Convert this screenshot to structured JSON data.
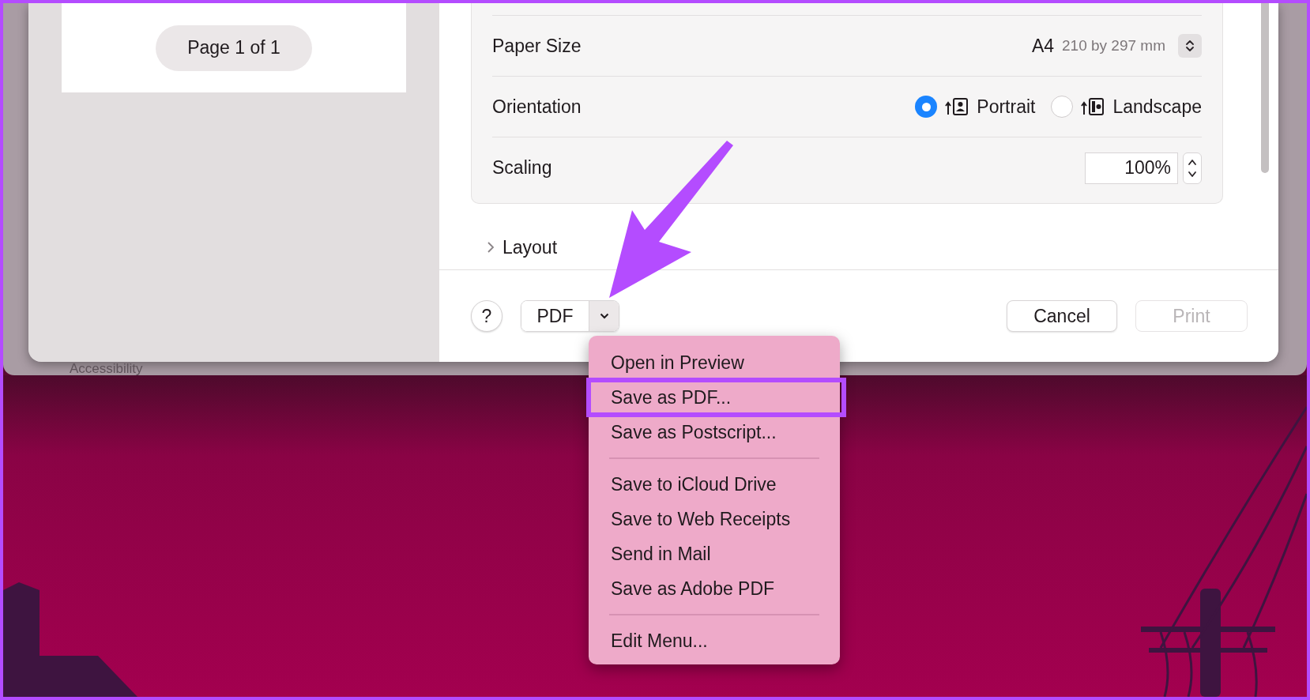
{
  "background_window": {
    "label": "Accessibility"
  },
  "preview": {
    "page_indicator": "Page 1 of 1"
  },
  "settings": {
    "rows": [
      {
        "kind": "select",
        "label": "Paper Size",
        "value": "A4",
        "detail": "210 by 297 mm"
      },
      {
        "kind": "radio",
        "label": "Orientation",
        "options": [
          {
            "label": "Portrait",
            "selected": true
          },
          {
            "label": "Landscape",
            "selected": false
          }
        ]
      },
      {
        "kind": "stepper",
        "label": "Scaling",
        "value": "100%"
      }
    ]
  },
  "sections": [
    {
      "label": "Layout",
      "expanded": false
    }
  ],
  "footer": {
    "help": "?",
    "pdf": "PDF",
    "cancel": "Cancel",
    "print": {
      "label": "Print",
      "disabled": true
    }
  },
  "menu": {
    "items": [
      {
        "kind": "item",
        "label": "Open in Preview",
        "annotated": false
      },
      {
        "kind": "item",
        "label": "Save as PDF...",
        "annotated": true
      },
      {
        "kind": "item",
        "label": "Save as Postscript...",
        "annotated": false
      },
      {
        "kind": "separator"
      },
      {
        "kind": "item",
        "label": "Save to iCloud Drive",
        "annotated": false
      },
      {
        "kind": "item",
        "label": "Save to Web Receipts",
        "annotated": false
      },
      {
        "kind": "item",
        "label": "Send in Mail",
        "annotated": false
      },
      {
        "kind": "item",
        "label": "Save as Adobe PDF",
        "annotated": false
      },
      {
        "kind": "separator"
      },
      {
        "kind": "item",
        "label": "Edit Menu...",
        "annotated": false
      }
    ]
  }
}
